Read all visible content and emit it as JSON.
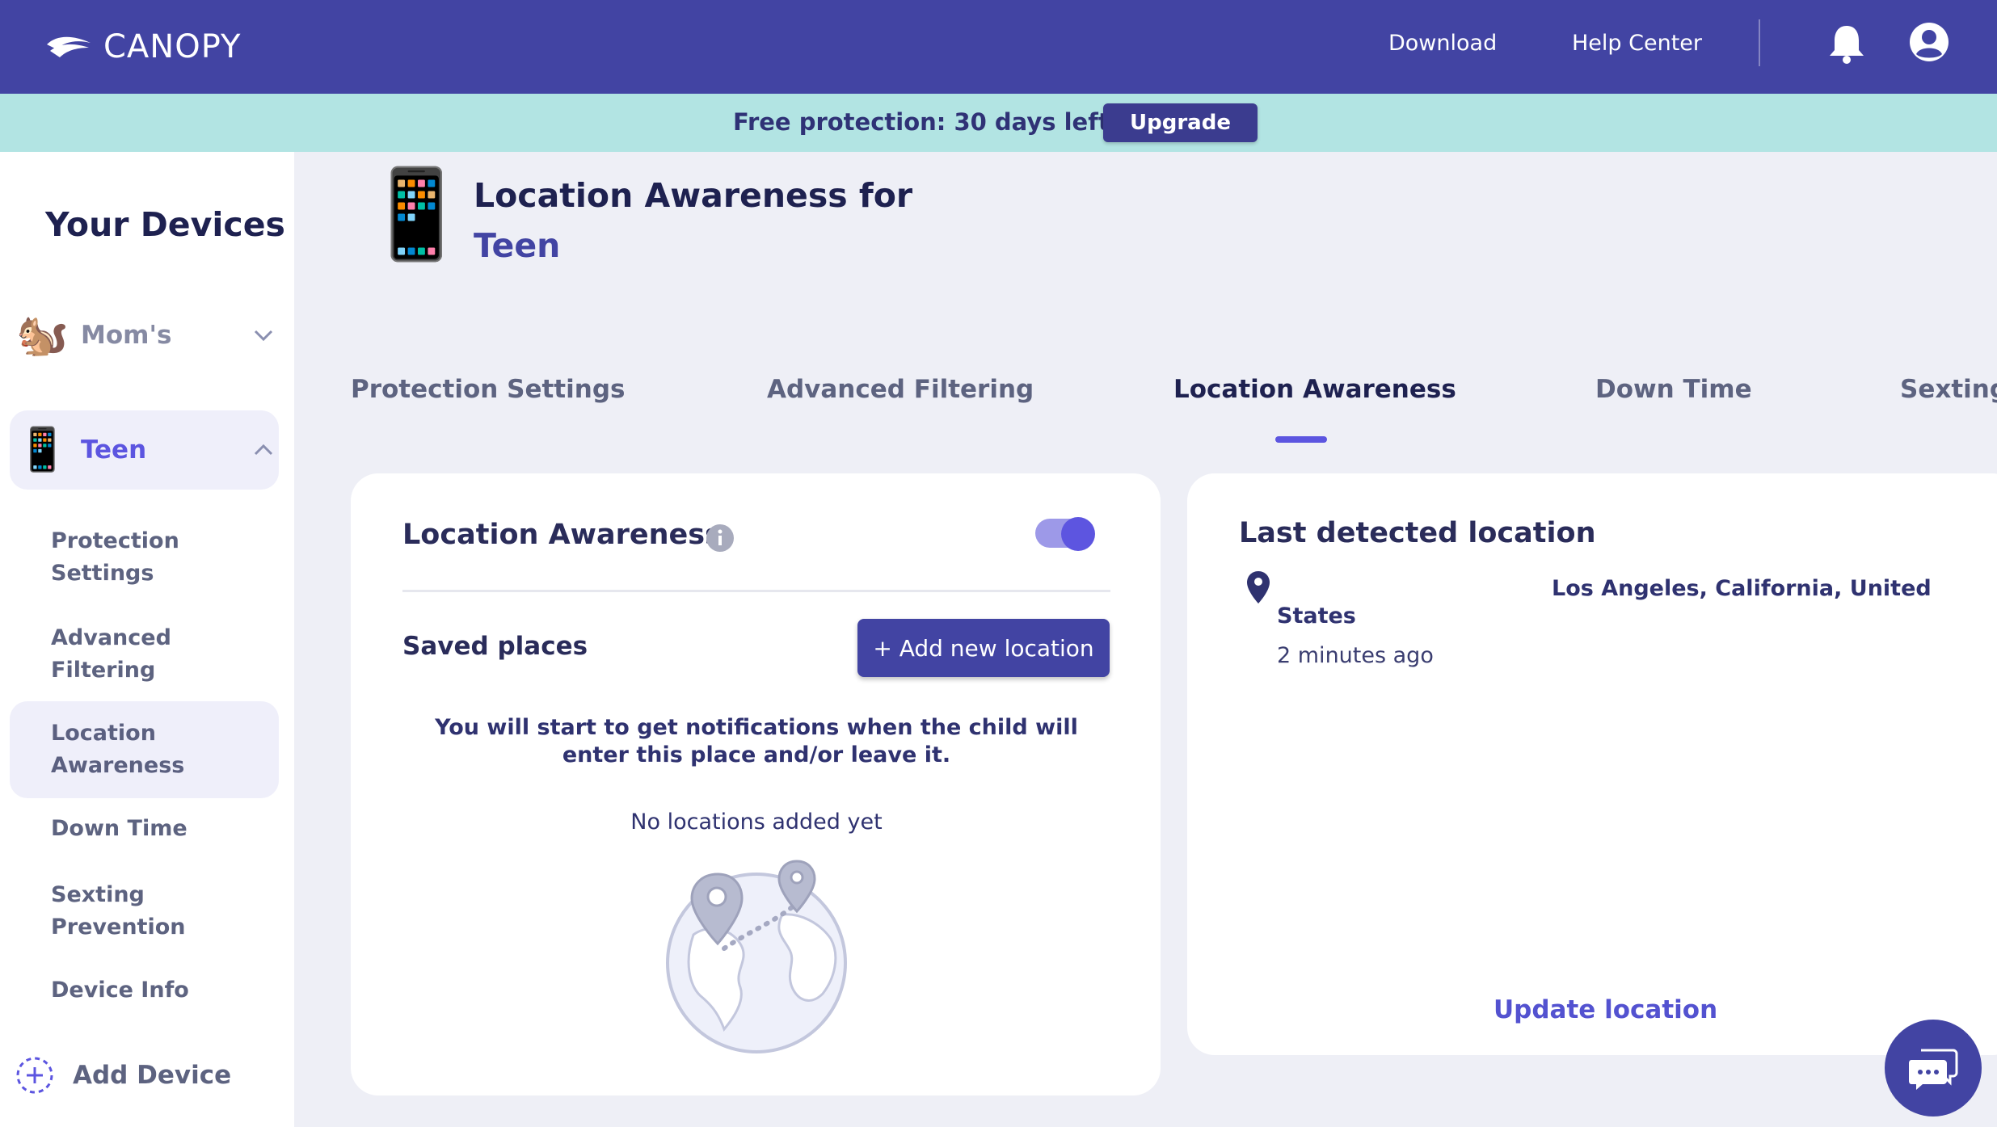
{
  "header": {
    "brand": "CANOPY",
    "nav": [
      "Download",
      "Help Center"
    ],
    "icons": [
      "bell-icon",
      "account-icon"
    ]
  },
  "promo": {
    "text": "Free protection: 30 days left",
    "button": "Upgrade"
  },
  "sidebar": {
    "title": "Your Devices",
    "devices": [
      {
        "name": "Mom's",
        "icon": "squirrel-emoji",
        "expanded": false
      },
      {
        "name": "Teen",
        "icon": "phone-emoji",
        "expanded": true
      }
    ],
    "sub_items": [
      "Protection Settings",
      "Advanced Filtering",
      "Location Awareness",
      "Down Time",
      "Sexting Prevention",
      "Device Info"
    ],
    "add_device": "Add Device"
  },
  "page": {
    "title_prefix": "Location Awareness for",
    "device_name": "Teen"
  },
  "tabs": [
    "Protection Settings",
    "Advanced Filtering",
    "Location Awareness",
    "Down Time",
    "Sexting"
  ],
  "location_card": {
    "title": "Location Awareness",
    "toggle_on": true,
    "saved_places_title": "Saved places",
    "add_button": "+ Add new location",
    "notice": "You will start to get notifications when the child will enter this place and/or leave it.",
    "empty_text": "No locations added yet"
  },
  "last_location": {
    "title": "Last detected location",
    "place": "Los Angeles, California, United",
    "place_cont": "States",
    "time": "2 minutes ago",
    "update_link": "Update location"
  },
  "colors": {
    "brand": "#4244a3",
    "promo_bg": "#b2e4e3",
    "accent": "#5c55e0"
  }
}
